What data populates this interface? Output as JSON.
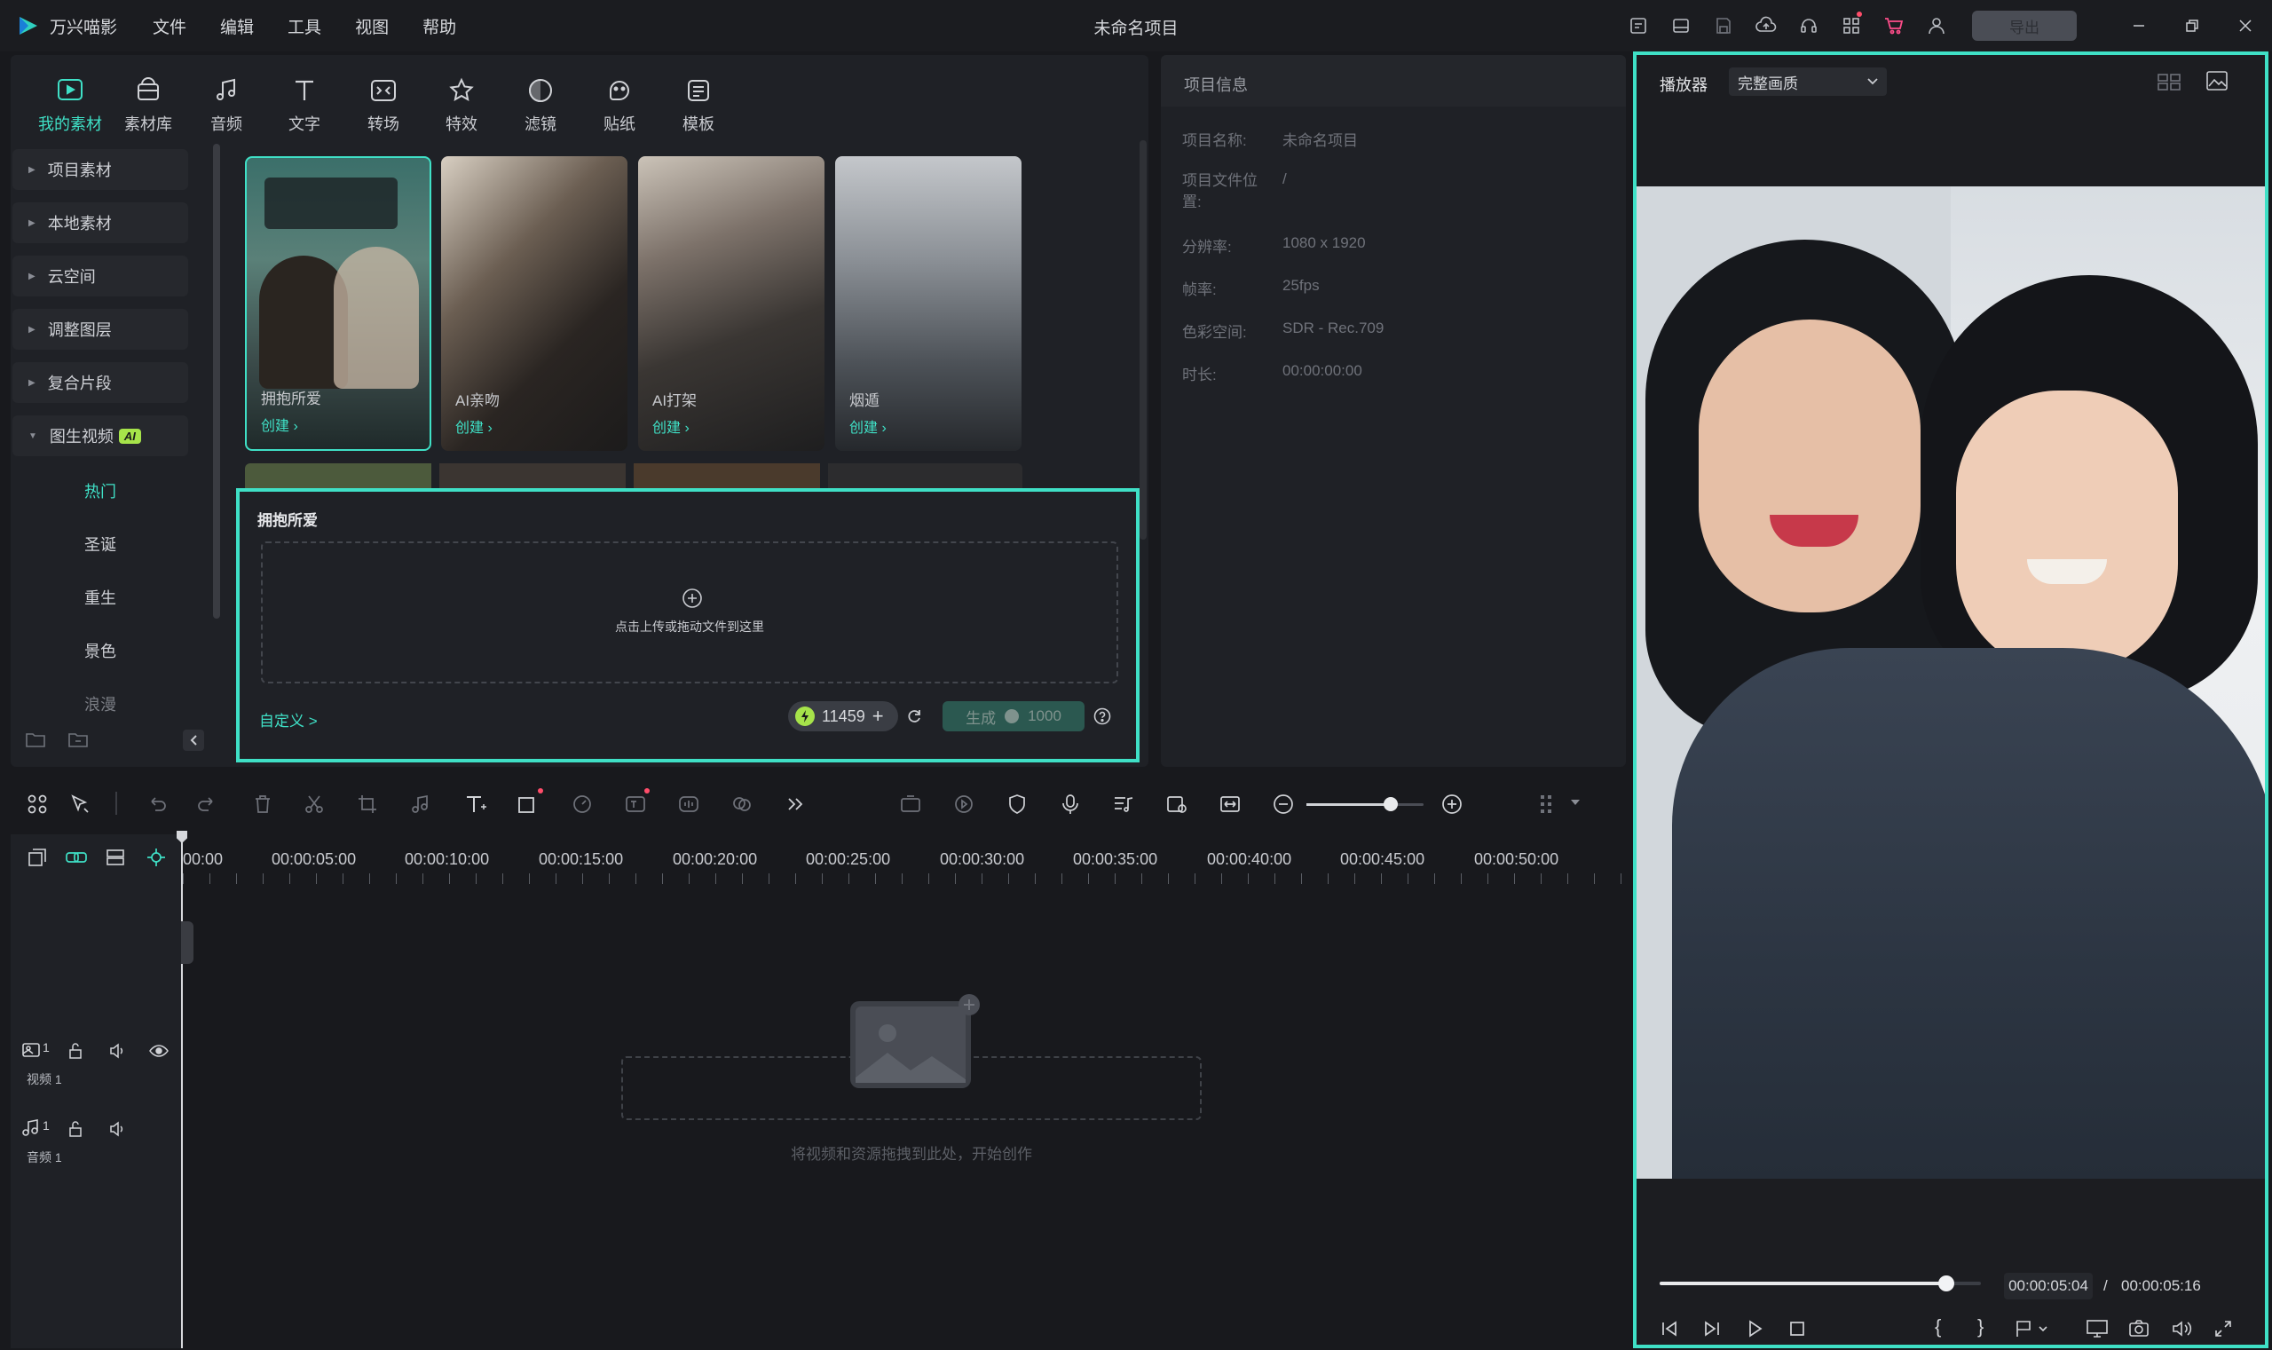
{
  "app": {
    "name": "万兴喵影",
    "project_title": "未命名项目",
    "export_label": "导出"
  },
  "menu": [
    "文件",
    "编辑",
    "工具",
    "视图",
    "帮助"
  ],
  "toolbar_tabs": [
    {
      "label": "我的素材",
      "icon": "my-media-icon"
    },
    {
      "label": "素材库",
      "icon": "library-icon"
    },
    {
      "label": "音频",
      "icon": "music-note-icon"
    },
    {
      "label": "文字",
      "icon": "text-icon"
    },
    {
      "label": "转场",
      "icon": "transition-icon"
    },
    {
      "label": "特效",
      "icon": "effects-star-icon"
    },
    {
      "label": "滤镜",
      "icon": "filter-icon"
    },
    {
      "label": "贴纸",
      "icon": "sticker-icon"
    },
    {
      "label": "模板",
      "icon": "template-icon"
    }
  ],
  "sidebar": {
    "items": [
      "项目素材",
      "本地素材",
      "云空间",
      "调整图层",
      "复合片段",
      "图生视频"
    ],
    "ai_badge": "AI",
    "subitems": [
      "热门",
      "圣诞",
      "重生",
      "景色",
      "浪漫"
    ]
  },
  "templates": [
    {
      "title": "拥抱所爱",
      "cta": "创建 ›"
    },
    {
      "title": "AI亲吻",
      "cta": "创建 ›"
    },
    {
      "title": "AI打架",
      "cta": "创建 ›"
    },
    {
      "title": "烟遁",
      "cta": "创建 ›"
    }
  ],
  "generate_panel": {
    "title": "拥抱所爱",
    "upload_hint": "点击上传或拖动文件到这里",
    "custom_link": "自定义 >",
    "credits": "11459",
    "generate_label": "生成",
    "cost": "1000"
  },
  "project_info": {
    "header": "项目信息",
    "rows": [
      {
        "label": "项目名称:",
        "value": "未命名项目"
      },
      {
        "label": "项目文件位置:",
        "value": "/"
      },
      {
        "label": "分辨率:",
        "value": "1080 x 1920"
      },
      {
        "label": "帧率:",
        "value": "25fps"
      },
      {
        "label": "色彩空间:",
        "value": "SDR - Rec.709"
      },
      {
        "label": "时长:",
        "value": "00:00:00:00"
      }
    ]
  },
  "timeline": {
    "ruler": [
      "00:00",
      "00:00:05:00",
      "00:00:10:00",
      "00:00:15:00",
      "00:00:20:00",
      "00:00:25:00",
      "00:00:30:00",
      "00:00:35:00",
      "00:00:40:00",
      "00:00:45:00",
      "00:00:50:00"
    ],
    "tracks": [
      {
        "label": "视频 1",
        "index": "1"
      },
      {
        "label": "音频 1",
        "index": "1"
      }
    ],
    "drop_hint": "将视频和资源拖拽到此处，开始创作",
    "zoom_level": 0.72
  },
  "player": {
    "label": "播放器",
    "quality": "完整画质",
    "current_time": "00:00:05:04",
    "separator": "/",
    "total_time": "00:00:05:16",
    "progress": 0.97
  },
  "colors": {
    "accent": "#3fe0c6",
    "bg": "#18191d",
    "panel": "#1f2126"
  }
}
